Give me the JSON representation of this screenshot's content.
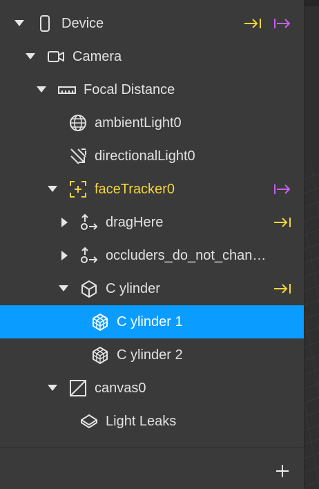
{
  "tree": {
    "device": "Device",
    "camera": "Camera",
    "focal_distance": "Focal Distance",
    "ambient_light": "ambientLight0",
    "directional_light": "directionalLight0",
    "face_tracker": "faceTracker0",
    "drag_here": "dragHere",
    "occluders": "occluders_do_not_chan…",
    "cylinder": "C ylinder",
    "cylinder_1": "C ylinder 1",
    "cylinder_2": "C ylinder 2",
    "canvas": "canvas0",
    "light_leaks": "Light Leaks"
  },
  "icons": {
    "device": "device-phone-icon",
    "camera": "camera-icon",
    "focal_distance": "ruler-icon",
    "ambient_light": "globe-icon",
    "directional_light": "directional-light-icon",
    "face_tracker": "face-tracker-icon",
    "drag_here": "transform-icon",
    "occluders": "transform-icon",
    "cylinder": "cube-icon",
    "cylinder_1": "mesh-icon",
    "cylinder_2": "mesh-icon",
    "canvas": "canvas-icon",
    "light_leaks": "plane-icon"
  },
  "colors": {
    "selected_row": "#0a9dff",
    "yellow_accent": "#f2d53c",
    "magenta_accent": "#c560f0",
    "panel_bg": "#3a3a3a"
  }
}
